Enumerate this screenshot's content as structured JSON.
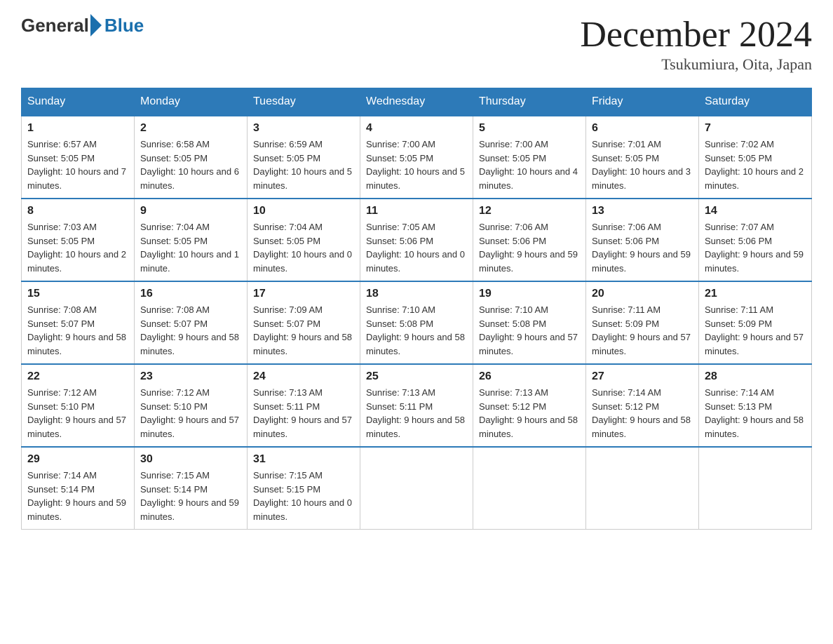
{
  "header": {
    "logo_general": "General",
    "logo_blue": "Blue",
    "month_title": "December 2024",
    "location": "Tsukumiura, Oita, Japan"
  },
  "days_of_week": [
    "Sunday",
    "Monday",
    "Tuesday",
    "Wednesday",
    "Thursday",
    "Friday",
    "Saturday"
  ],
  "weeks": [
    [
      {
        "num": "1",
        "sunrise": "6:57 AM",
        "sunset": "5:05 PM",
        "daylight": "10 hours and 7 minutes."
      },
      {
        "num": "2",
        "sunrise": "6:58 AM",
        "sunset": "5:05 PM",
        "daylight": "10 hours and 6 minutes."
      },
      {
        "num": "3",
        "sunrise": "6:59 AM",
        "sunset": "5:05 PM",
        "daylight": "10 hours and 5 minutes."
      },
      {
        "num": "4",
        "sunrise": "7:00 AM",
        "sunset": "5:05 PM",
        "daylight": "10 hours and 5 minutes."
      },
      {
        "num": "5",
        "sunrise": "7:00 AM",
        "sunset": "5:05 PM",
        "daylight": "10 hours and 4 minutes."
      },
      {
        "num": "6",
        "sunrise": "7:01 AM",
        "sunset": "5:05 PM",
        "daylight": "10 hours and 3 minutes."
      },
      {
        "num": "7",
        "sunrise": "7:02 AM",
        "sunset": "5:05 PM",
        "daylight": "10 hours and 2 minutes."
      }
    ],
    [
      {
        "num": "8",
        "sunrise": "7:03 AM",
        "sunset": "5:05 PM",
        "daylight": "10 hours and 2 minutes."
      },
      {
        "num": "9",
        "sunrise": "7:04 AM",
        "sunset": "5:05 PM",
        "daylight": "10 hours and 1 minute."
      },
      {
        "num": "10",
        "sunrise": "7:04 AM",
        "sunset": "5:05 PM",
        "daylight": "10 hours and 0 minutes."
      },
      {
        "num": "11",
        "sunrise": "7:05 AM",
        "sunset": "5:06 PM",
        "daylight": "10 hours and 0 minutes."
      },
      {
        "num": "12",
        "sunrise": "7:06 AM",
        "sunset": "5:06 PM",
        "daylight": "9 hours and 59 minutes."
      },
      {
        "num": "13",
        "sunrise": "7:06 AM",
        "sunset": "5:06 PM",
        "daylight": "9 hours and 59 minutes."
      },
      {
        "num": "14",
        "sunrise": "7:07 AM",
        "sunset": "5:06 PM",
        "daylight": "9 hours and 59 minutes."
      }
    ],
    [
      {
        "num": "15",
        "sunrise": "7:08 AM",
        "sunset": "5:07 PM",
        "daylight": "9 hours and 58 minutes."
      },
      {
        "num": "16",
        "sunrise": "7:08 AM",
        "sunset": "5:07 PM",
        "daylight": "9 hours and 58 minutes."
      },
      {
        "num": "17",
        "sunrise": "7:09 AM",
        "sunset": "5:07 PM",
        "daylight": "9 hours and 58 minutes."
      },
      {
        "num": "18",
        "sunrise": "7:10 AM",
        "sunset": "5:08 PM",
        "daylight": "9 hours and 58 minutes."
      },
      {
        "num": "19",
        "sunrise": "7:10 AM",
        "sunset": "5:08 PM",
        "daylight": "9 hours and 57 minutes."
      },
      {
        "num": "20",
        "sunrise": "7:11 AM",
        "sunset": "5:09 PM",
        "daylight": "9 hours and 57 minutes."
      },
      {
        "num": "21",
        "sunrise": "7:11 AM",
        "sunset": "5:09 PM",
        "daylight": "9 hours and 57 minutes."
      }
    ],
    [
      {
        "num": "22",
        "sunrise": "7:12 AM",
        "sunset": "5:10 PM",
        "daylight": "9 hours and 57 minutes."
      },
      {
        "num": "23",
        "sunrise": "7:12 AM",
        "sunset": "5:10 PM",
        "daylight": "9 hours and 57 minutes."
      },
      {
        "num": "24",
        "sunrise": "7:13 AM",
        "sunset": "5:11 PM",
        "daylight": "9 hours and 57 minutes."
      },
      {
        "num": "25",
        "sunrise": "7:13 AM",
        "sunset": "5:11 PM",
        "daylight": "9 hours and 58 minutes."
      },
      {
        "num": "26",
        "sunrise": "7:13 AM",
        "sunset": "5:12 PM",
        "daylight": "9 hours and 58 minutes."
      },
      {
        "num": "27",
        "sunrise": "7:14 AM",
        "sunset": "5:12 PM",
        "daylight": "9 hours and 58 minutes."
      },
      {
        "num": "28",
        "sunrise": "7:14 AM",
        "sunset": "5:13 PM",
        "daylight": "9 hours and 58 minutes."
      }
    ],
    [
      {
        "num": "29",
        "sunrise": "7:14 AM",
        "sunset": "5:14 PM",
        "daylight": "9 hours and 59 minutes."
      },
      {
        "num": "30",
        "sunrise": "7:15 AM",
        "sunset": "5:14 PM",
        "daylight": "9 hours and 59 minutes."
      },
      {
        "num": "31",
        "sunrise": "7:15 AM",
        "sunset": "5:15 PM",
        "daylight": "10 hours and 0 minutes."
      },
      null,
      null,
      null,
      null
    ]
  ],
  "labels": {
    "sunrise_prefix": "Sunrise: ",
    "sunset_prefix": "Sunset: ",
    "daylight_prefix": "Daylight: "
  }
}
